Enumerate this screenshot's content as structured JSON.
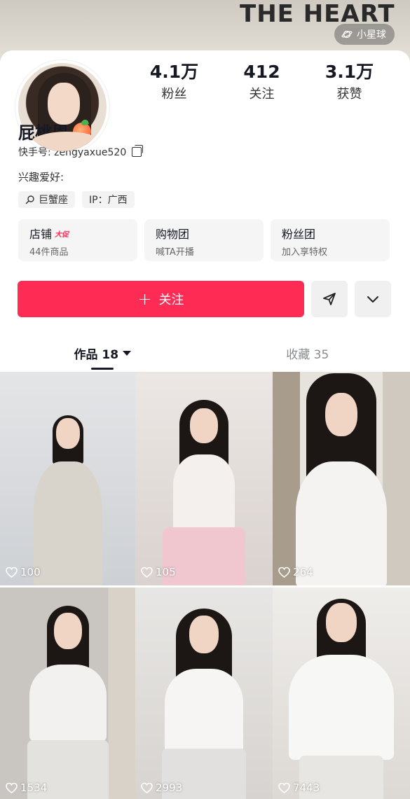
{
  "banner": {
    "text": "THE HEART",
    "planet_label": "小星球"
  },
  "stats": [
    {
      "value": "4.1万",
      "label": "粉丝"
    },
    {
      "value": "412",
      "label": "关注"
    },
    {
      "value": "3.1万",
      "label": "获赞"
    }
  ],
  "profile": {
    "nickname": "屁桃恩",
    "kuaishou_id": "快手号: zengyaxue520",
    "hobby": "兴趣爱好:",
    "tags": [
      "巨蟹座",
      "IP：广西"
    ]
  },
  "features": [
    {
      "title": "店铺",
      "badge": "大促",
      "sub": "44件商品"
    },
    {
      "title": "购物团",
      "badge": "",
      "sub": "喊TA开播"
    },
    {
      "title": "粉丝团",
      "badge": "",
      "sub": "加入享特权"
    }
  ],
  "actions": {
    "follow_label": "关注"
  },
  "tabs": [
    {
      "label": "作品 18"
    },
    {
      "label": "收藏 35"
    }
  ],
  "works": [
    {
      "likes": "100"
    },
    {
      "likes": "105"
    },
    {
      "likes": "264"
    },
    {
      "likes": "1534"
    },
    {
      "likes": "2993"
    },
    {
      "likes": "7443"
    }
  ],
  "colors": {
    "accent": "#fe2c55",
    "text": "#161823",
    "muted": "#8a8b91"
  }
}
